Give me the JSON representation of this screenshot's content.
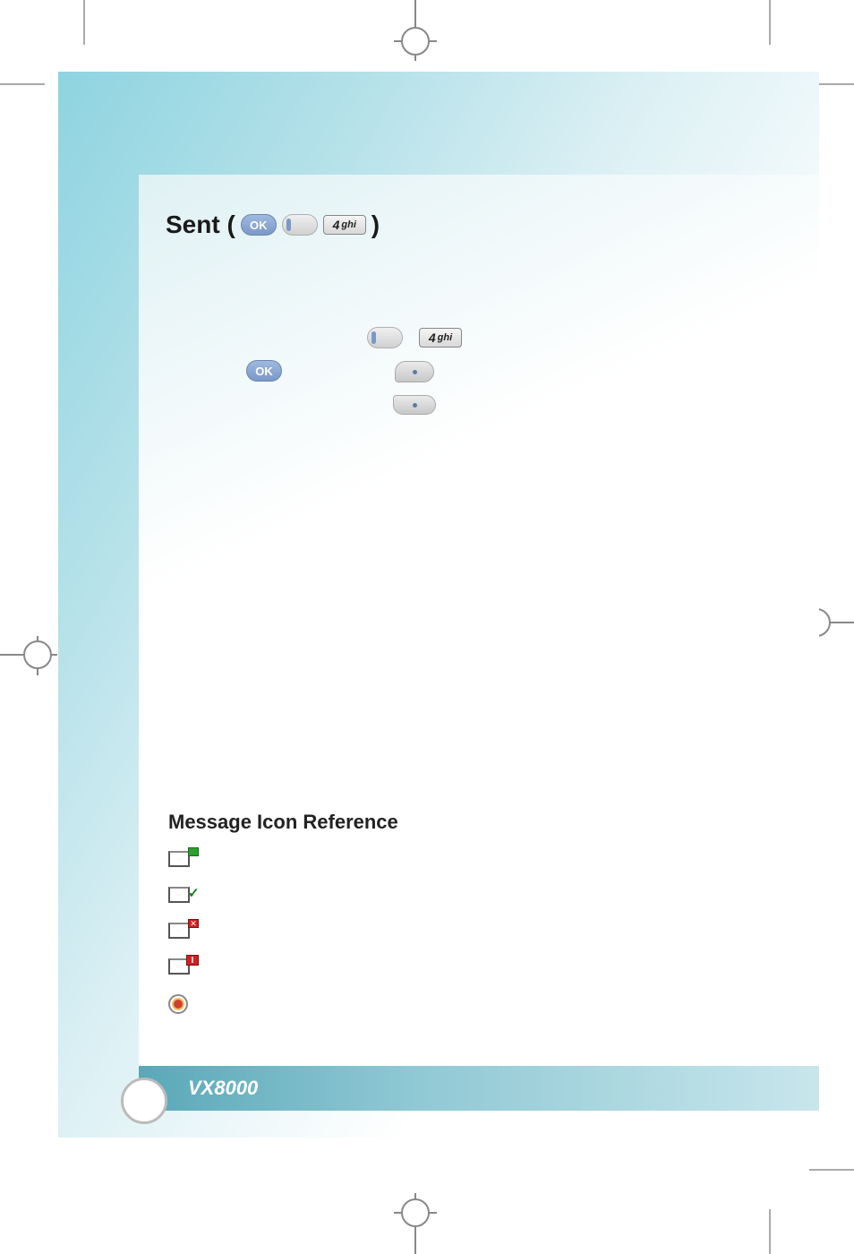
{
  "header": {
    "title_prefix": "Sent (",
    "title_suffix": ")",
    "ok_label": "OK",
    "key4_num": "4",
    "key4_letters": "ghi"
  },
  "mid": {
    "ok_label": "OK",
    "key4_num": "4",
    "key4_letters": "ghi"
  },
  "ref_section": {
    "title": "Message Icon Reference"
  },
  "footer": {
    "model": "VX8000"
  }
}
